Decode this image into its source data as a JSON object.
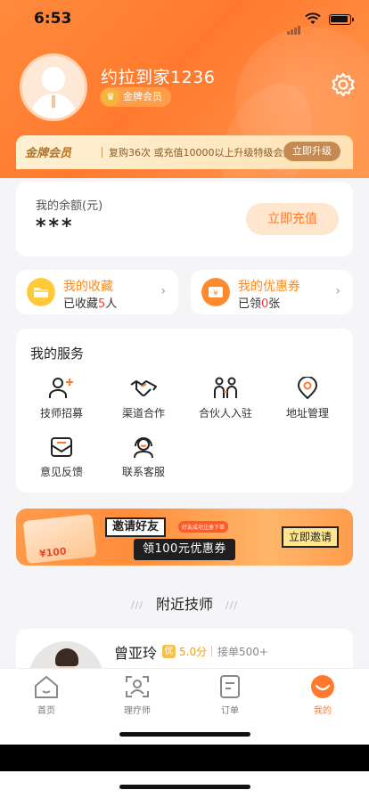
{
  "status_bar": {
    "time": "6:53"
  },
  "profile": {
    "username": "约拉到家1236",
    "badge_label": "金牌会员"
  },
  "vip_bar": {
    "title": "金牌会员",
    "description": "复购36次 或充值10000以上升级特级会员",
    "button": "立即升级"
  },
  "balance": {
    "label": "我的余额(元)",
    "amount": "***",
    "button": "立即充值"
  },
  "favorites": {
    "title": "我的收藏",
    "prefix": "已收藏",
    "count": "5",
    "suffix": "人"
  },
  "coupons": {
    "title": "我的优惠券",
    "prefix": "已领",
    "count": "0",
    "suffix": "张"
  },
  "services": {
    "title": "我的服务",
    "items": [
      {
        "label": "技师招募",
        "icon": "person-add-icon"
      },
      {
        "label": "渠道合作",
        "icon": "handshake-icon"
      },
      {
        "label": "合伙人入驻",
        "icon": "partners-icon"
      },
      {
        "label": "地址管理",
        "icon": "location-pin-icon"
      },
      {
        "label": "意见反馈",
        "icon": "feedback-icon"
      },
      {
        "label": "联系客服",
        "icon": "headset-icon"
      }
    ]
  },
  "invite_banner": {
    "title": "邀请好友",
    "subtitle": "好友成功注册下单",
    "coupon_text": "领100元优惠券",
    "gift_tag": "¥100",
    "button": "立即邀请"
  },
  "nearby": {
    "title": "附近技师",
    "dash": "///"
  },
  "technician": {
    "name": "曾亚玲",
    "tag": "优",
    "score": "5.0分",
    "orders": "接单500+"
  },
  "tabbar": {
    "tabs": [
      {
        "label": "首页",
        "icon": "home-icon"
      },
      {
        "label": "理疗师",
        "icon": "therapist-icon"
      },
      {
        "label": "订单",
        "icon": "order-icon"
      },
      {
        "label": "我的",
        "icon": "mine-icon",
        "active": true
      }
    ]
  },
  "colors": {
    "accent": "#ff7a2e",
    "gold": "#c48a52",
    "highlight": "#ff3b30"
  }
}
